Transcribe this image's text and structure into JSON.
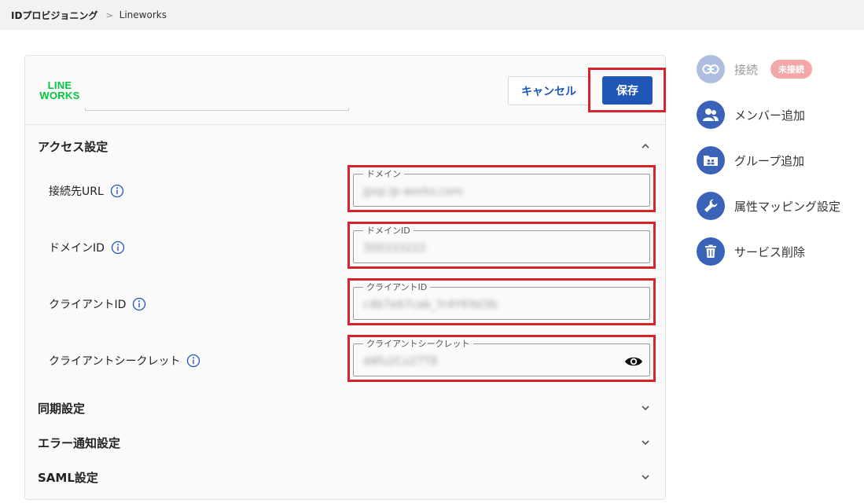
{
  "breadcrumb": {
    "root": "IDプロビジョニング",
    "separator": ">",
    "current": "Lineworks"
  },
  "header": {
    "logo_line1": "LINE",
    "logo_line2": "WORKS",
    "cancel_label": "キャンセル",
    "save_label": "保存"
  },
  "sections": {
    "access": {
      "title": "アクセス設定"
    },
    "sync": {
      "title": "同期設定"
    },
    "error": {
      "title": "エラー通知設定"
    },
    "saml": {
      "title": "SAML設定"
    }
  },
  "fields": [
    {
      "label": "接続先URL",
      "legend": "ドメイン",
      "value": "jpsp.lp-works.com"
    },
    {
      "label": "ドメインID",
      "legend": "ドメインID",
      "value": "300333222"
    },
    {
      "label": "クライアントID",
      "legend": "クライアントID",
      "value": "c4b7e67cab_Yr4Y6Yol3b"
    },
    {
      "label": "クライアントシークレット",
      "legend": "クライアントシークレット",
      "value": "d4fu2Cu27T8"
    }
  ],
  "sidebar": {
    "connect_label": "接続",
    "connect_status": "未接続",
    "add_member_label": "メンバー追加",
    "add_group_label": "グループ追加",
    "attr_mapping_label": "属性マッピング設定",
    "delete_service_label": "サービス削除"
  },
  "colors": {
    "primary": "#1f57b6",
    "highlight": "#d9232b",
    "line_green": "#00c73c",
    "badge": "#f2a8a8"
  }
}
